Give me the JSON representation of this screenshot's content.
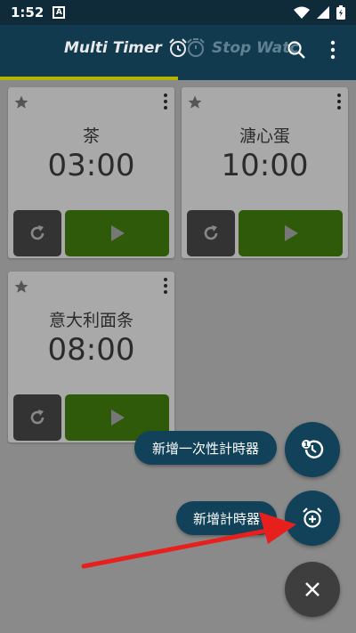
{
  "status_bar": {
    "time": "1:52",
    "notification_letter": "A"
  },
  "app_bar": {
    "tabs": [
      {
        "label": "Multi Timer",
        "icon": "alarm-clock-icon",
        "selected": true
      },
      {
        "label": "Stop Watc",
        "icon": "stopwatch-icon",
        "selected": false
      }
    ]
  },
  "timers": [
    {
      "name": "茶",
      "time": "03:00"
    },
    {
      "name": "溏心蛋",
      "time": "10:00"
    },
    {
      "name": "意大利面条",
      "time": "08:00"
    }
  ],
  "fab_menu": {
    "add_one_time_label": "新增一次性計時器",
    "add_timer_label": "新增計時器"
  },
  "colors": {
    "primary": "#12425a",
    "status_bar": "#0f2b3a",
    "tab_indicator": "#b2b400",
    "play_button": "#2f5a0a",
    "reset_button": "#333333",
    "arrow": "#e8201d"
  }
}
